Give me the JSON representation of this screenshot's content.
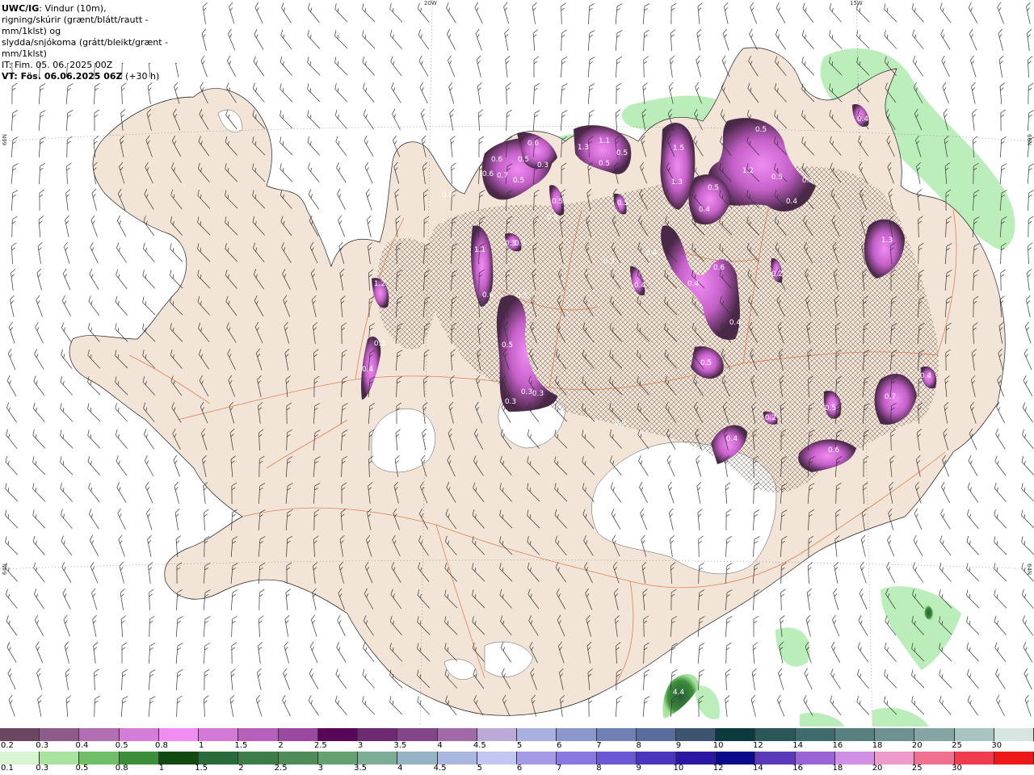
{
  "header": {
    "title": "UWC/IG",
    "line1": ": Vindur (10m),",
    "line2": "rigning/skúrir (grænt/blátt/rautt - mm/1klst) og",
    "line3": "slydda/snjókoma (grátt/bleikt/grænt - mm/1klst)",
    "it": "IT: Fim. 05. 06. 2025 00Z",
    "vt": "VT: Fös. 06.06.2025 06Z",
    "vt_offset": "(+30 h)"
  },
  "coords": {
    "top_20w": "20W",
    "top_15w": "15W",
    "left_66n": "66N",
    "right_66n": "66N",
    "left_64n": "64N",
    "right_64n": "64N"
  },
  "legend": {
    "snow_ticks": [
      "0.2",
      "0.3",
      "0.4",
      "0.5",
      "0.8",
      "1",
      "1.5",
      "2",
      "2.5",
      "3",
      "3.5",
      "4",
      "4.5",
      "5",
      "6",
      "7",
      "8",
      "9",
      "10",
      "12",
      "14",
      "16",
      "18",
      "20",
      "25",
      "30"
    ],
    "snow_colors": [
      "#6b4660",
      "#8e5a8a",
      "#b16eb2",
      "#d57cdb",
      "#f08cf2",
      "#d47ad6",
      "#b760bb",
      "#9a48a0",
      "#590659",
      "#6e2a70",
      "#844488",
      "#a06aa8",
      "#bbaad8",
      "#a8b0e0",
      "#8c98cc",
      "#7080b4",
      "#5a6c9c",
      "#3d5470",
      "#0a3a3e",
      "#2a5858",
      "#3e6c6c",
      "#58807e",
      "#6e9292",
      "#86a4a2",
      "#a8c4c0",
      "#d8e6e2"
    ],
    "rain_ticks": [
      "0.1",
      "0.3",
      "0.5",
      "0.8",
      "1",
      "1.5",
      "2",
      "2.5",
      "3",
      "3.5",
      "4",
      "4.5",
      "5",
      "6",
      "7",
      "8",
      "9",
      "10",
      "12",
      "14",
      "16",
      "18",
      "20",
      "25",
      "30"
    ],
    "rain_colors": [
      "#d6f5d0",
      "#a8e4a0",
      "#6ebf68",
      "#3c8e3a",
      "#104a10",
      "#2a6a38",
      "#3c7c48",
      "#4f8c5a",
      "#64a070",
      "#7cae96",
      "#94b4c4",
      "#aab8e0",
      "#c2c6f2",
      "#a49ae8",
      "#8878e0",
      "#6a58d4",
      "#4a36bc",
      "#2a18a4",
      "#0a0a8a",
      "#5a3ab8",
      "#9a64d6",
      "#d090e4",
      "#ee9acc",
      "#f07090",
      "#f03c4c",
      "#ee1818"
    ]
  },
  "map": {
    "land_color": "#f2e4d6",
    "ice_color": "#ffffff",
    "rain_color": "#b4ecb4",
    "road_color": "#e07040"
  },
  "labels": [
    {
      "t": "1.3"
    },
    {
      "t": "1.1"
    },
    {
      "t": "0.5"
    },
    {
      "t": "0.5"
    },
    {
      "t": "1.5"
    },
    {
      "t": "1.3"
    },
    {
      "t": "0.5"
    },
    {
      "t": "1.2"
    },
    {
      "t": "0.5"
    },
    {
      "t": "0.3"
    },
    {
      "t": "0.5"
    },
    {
      "t": "0.4"
    },
    {
      "t": "0.4"
    },
    {
      "t": "0.6"
    },
    {
      "t": "0.5"
    },
    {
      "t": "0.7"
    },
    {
      "t": "0.6"
    },
    {
      "t": "0.5"
    },
    {
      "t": "0.3"
    },
    {
      "t": "0.6"
    },
    {
      "t": "0.5"
    },
    {
      "t": "0.5"
    },
    {
      "t": "0.6"
    },
    {
      "t": "0.3"
    },
    {
      "t": "0.3"
    },
    {
      "t": "1.1"
    },
    {
      "t": "0.6"
    },
    {
      "t": "1.2"
    },
    {
      "t": "0.5"
    },
    {
      "t": "0.5"
    },
    {
      "t": "0.4"
    },
    {
      "t": "0.3"
    },
    {
      "t": "0.3"
    },
    {
      "t": "0.3"
    },
    {
      "t": "0.5"
    },
    {
      "t": "0.4"
    },
    {
      "t": "0.6"
    },
    {
      "t": "0.4"
    },
    {
      "t": "0.4"
    },
    {
      "t": "0.3"
    },
    {
      "t": "0.4"
    },
    {
      "t": "0.5"
    },
    {
      "t": "1.3"
    },
    {
      "t": "0.7"
    },
    {
      "t": "0.4"
    },
    {
      "t": "0.5"
    },
    {
      "t": "0.2"
    },
    {
      "t": "0.3"
    },
    {
      "t": "0.4"
    },
    {
      "t": "0.6"
    },
    {
      "t": "4.4"
    },
    {
      "t": "0.2"
    },
    {
      "t": "0.3"
    },
    {
      "t": "0.4"
    }
  ]
}
